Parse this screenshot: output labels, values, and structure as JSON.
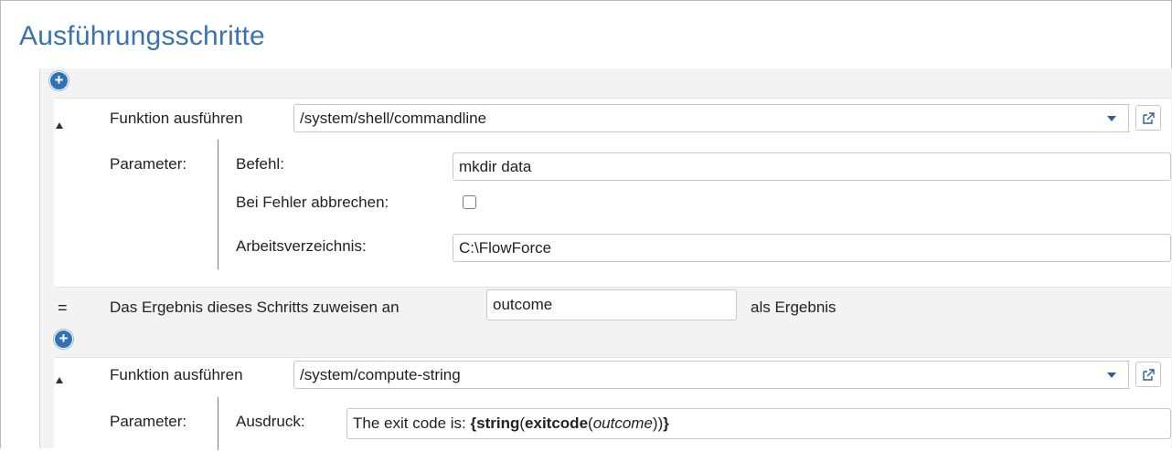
{
  "page": {
    "title": "Ausführungsschritte"
  },
  "add_label": "+",
  "step1": {
    "label": "Funktion ausführen",
    "function": "/system/shell/commandline",
    "params_label": "Parameter:",
    "params": {
      "befehl": {
        "label": "Befehl:",
        "value": "mkdir data"
      },
      "abbrechen": {
        "label": "Bei Fehler abbrechen:",
        "checked": false
      },
      "arbeitsverzeichnis": {
        "label": "Arbeitsverzeichnis:",
        "value": "C:\\FlowForce"
      }
    }
  },
  "assign": {
    "eq": "=",
    "prefix": "Das Ergebnis dieses Schritts zuweisen an",
    "value": "outcome",
    "suffix": "als Ergebnis"
  },
  "step2": {
    "label": "Funktion ausführen",
    "function": "/system/compute-string",
    "params_label": "Parameter:",
    "params": {
      "ausdruck": {
        "label": "Ausdruck:",
        "text_prefix": "The exit code is: ",
        "brace_open": "{",
        "fn1": "string",
        "paren_open1": "(",
        "fn2": "exitcode",
        "paren_open2": "(",
        "arg": "outcome",
        "paren_close": "))",
        "brace_close": "}"
      }
    }
  },
  "colors": {
    "title": "#3a73b0",
    "accent": "#2f72b8",
    "background": "#f3f3f3"
  },
  "icons": {
    "add": "plus-circle-icon",
    "collapse": "triangle-collapse-icon",
    "dropdown": "chevron-down-icon",
    "external": "open-external-icon"
  }
}
